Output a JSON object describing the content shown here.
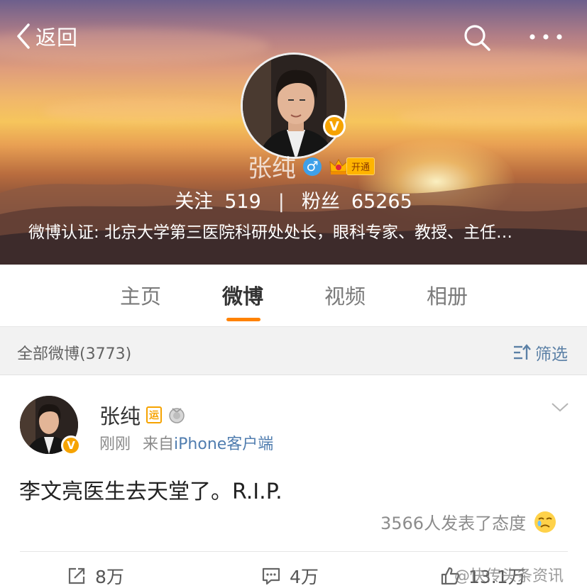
{
  "header": {
    "back_label": "返回",
    "profile_name": "张纯",
    "gender_symbol": "♂",
    "vip_label": "开通",
    "verified_mark": "V",
    "following_label": "关注",
    "following_count": "519",
    "separator": "|",
    "followers_label": "粉丝",
    "followers_count": "65265",
    "verification": "微博认证: 北京大学第三医院科研处处长，眼科专家、教授、主任…"
  },
  "tabs": [
    {
      "label": "主页",
      "active": false
    },
    {
      "label": "微博",
      "active": true
    },
    {
      "label": "视频",
      "active": false
    },
    {
      "label": "相册",
      "active": false
    }
  ],
  "filter": {
    "all_label": "全部微博(3773)",
    "filter_label": "筛选"
  },
  "post": {
    "author": "张纯",
    "badge_text": "运",
    "time": "刚刚",
    "source_prefix": "来自",
    "source": "iPhone客户端",
    "text": "李文亮医生去天堂了。R.I.P.",
    "attitude": "3566人发表了态度",
    "repost_count": "8万",
    "comment_count": "4万",
    "like_count": "13.1万"
  },
  "watermark": "@快传头条资讯",
  "colors": {
    "accent": "#ff8200",
    "link": "#507daf",
    "verified": "#f6a300",
    "gender": "#3fa0e8"
  },
  "icons": [
    "back-icon",
    "search-icon",
    "more-icon",
    "filter-icon",
    "chevron-down-icon",
    "cry-emoji-icon",
    "repost-icon",
    "comment-icon",
    "like-icon"
  ]
}
